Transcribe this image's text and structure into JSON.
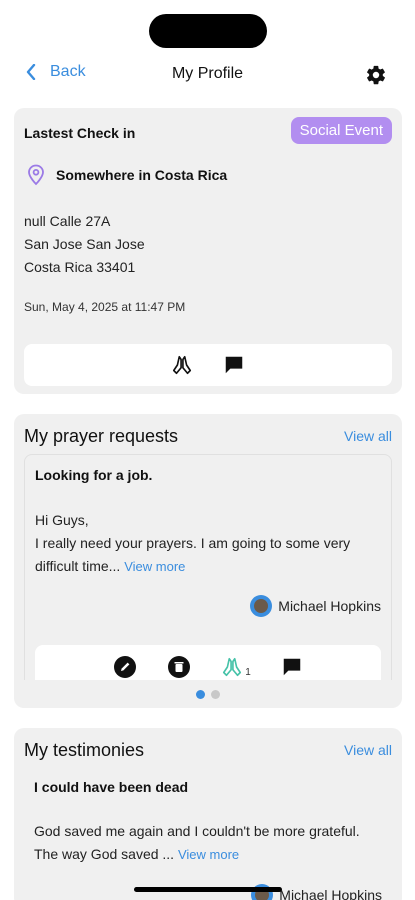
{
  "nav": {
    "back_label": "Back",
    "title": "My Profile"
  },
  "checkin": {
    "label": "Lastest Check in",
    "tag": "Social Event",
    "location": "Somewhere in Costa Rica",
    "address_lines": [
      "null Calle 27A",
      "San Jose San Jose",
      "Costa Rica 33401"
    ],
    "date": "Sun, May 4, 2025 at 11:47 PM"
  },
  "prayer": {
    "title": "My prayer requests",
    "view_all": "View all",
    "item": {
      "title": "Looking for a job.",
      "greeting": "Hi Guys,",
      "body": "I really need your prayers. I am going to some very difficult time...",
      "more": "View more",
      "author": "Michael Hopkins",
      "pray_count": "1"
    }
  },
  "testimonies": {
    "title": "My testimonies",
    "view_all": "View all",
    "item": {
      "title": "I could have been dead",
      "body": "God saved me again and I couldn't be more grateful. The way God saved ...",
      "more": "View more",
      "author": "Michael Hopkins"
    }
  },
  "colors": {
    "accent": "#3a8dde",
    "tag": "#b28ef0",
    "pray_active": "#46c2a8"
  }
}
